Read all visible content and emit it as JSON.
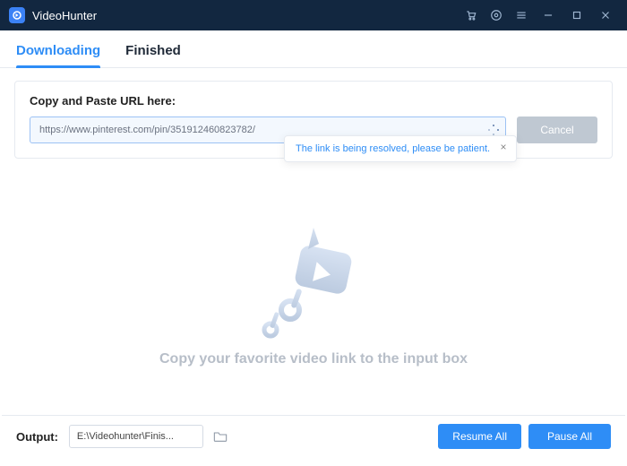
{
  "app": {
    "title": "VideoHunter"
  },
  "tabs": {
    "downloading": "Downloading",
    "finished": "Finished",
    "active": "downloading"
  },
  "url_section": {
    "label": "Copy and Paste URL here:",
    "value": "https://www.pinterest.com/pin/351912460823782/",
    "cancel": "Cancel"
  },
  "tooltip": {
    "text": "The link is being resolved, please be patient."
  },
  "empty": {
    "text": "Copy your favorite video link to the input box"
  },
  "footer": {
    "output_label": "Output:",
    "output_path": "E:\\Videohunter\\Finis...",
    "resume_all": "Resume All",
    "pause_all": "Pause All"
  },
  "colors": {
    "accent": "#2e8df6",
    "titlebar": "#122740"
  }
}
